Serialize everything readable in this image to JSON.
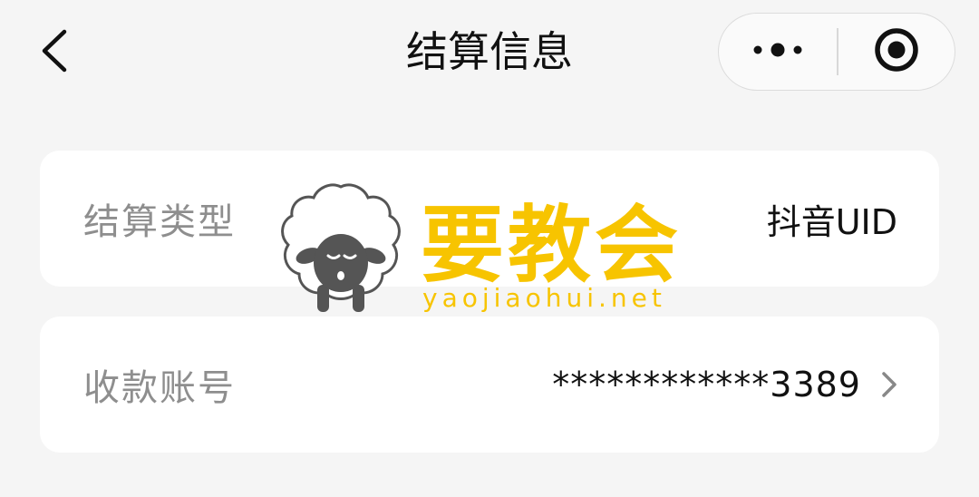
{
  "navbar": {
    "title": "结算信息",
    "back_icon": "chevron-left-icon",
    "more_icon": "more-dots-icon",
    "close_icon": "target-circle-icon"
  },
  "settlement": {
    "type_label": "结算类型",
    "type_value": "抖音UID",
    "account_label": "收款账号",
    "account_value": "************3389",
    "account_chevron_icon": "chevron-right-icon"
  },
  "watermark": {
    "brand_cn": "要教会",
    "brand_url": "yaojiaohui.net",
    "color": "#f7c400"
  },
  "colors": {
    "background": "#f5f5f5",
    "card": "#ffffff",
    "label_text": "#8e8e8e",
    "value_text": "#111111"
  }
}
